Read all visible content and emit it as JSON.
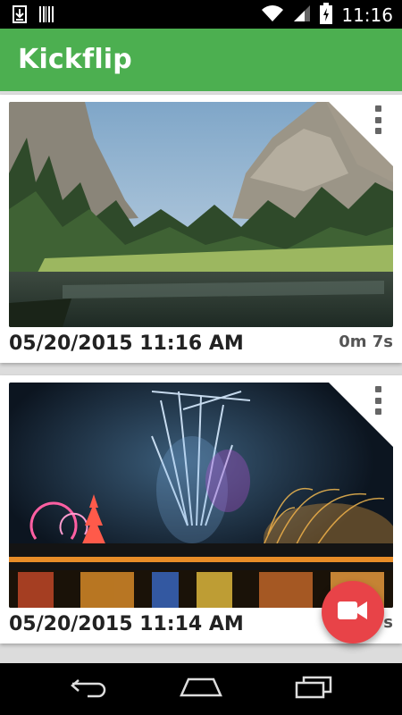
{
  "status_bar": {
    "time": "11:16",
    "icons": [
      "download-icon",
      "barcode-icon",
      "wifi-icon",
      "signal-icon",
      "battery-charging-icon"
    ]
  },
  "app_bar": {
    "title": "Kickflip",
    "color": "#4caf50"
  },
  "videos": [
    {
      "date": "05/20/2015 11:16 AM",
      "duration": "0m 7s",
      "thumbnail": "yosemite-valley-landscape"
    },
    {
      "date": "05/20/2015 11:14 AM",
      "duration": "0m 7s",
      "thumbnail": "night-fireworks-amusement-park"
    }
  ],
  "fab": {
    "icon": "video-camera-icon",
    "color": "#e84348"
  },
  "nav_bar": {
    "buttons": [
      "back-icon",
      "home-icon",
      "recents-icon"
    ]
  }
}
